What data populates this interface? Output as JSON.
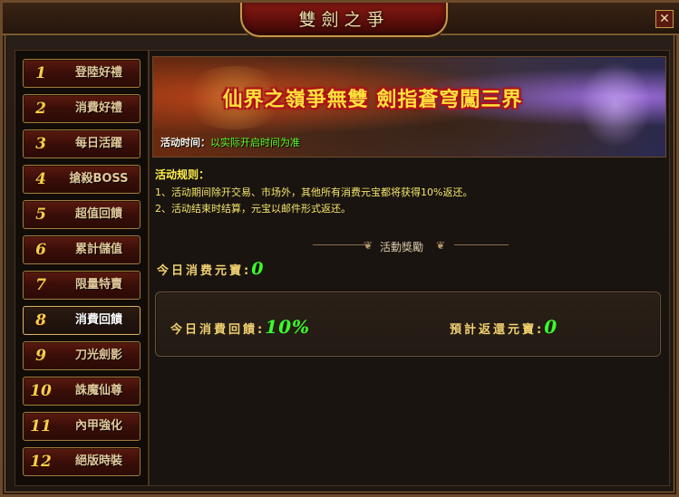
{
  "window": {
    "title": "雙劍之爭",
    "close_label": "✕"
  },
  "sidebar": {
    "items": [
      {
        "num": "1",
        "label": "登陸好禮"
      },
      {
        "num": "2",
        "label": "消費好禮"
      },
      {
        "num": "3",
        "label": "每日活躍"
      },
      {
        "num": "4",
        "label": "搶殺BOSS"
      },
      {
        "num": "5",
        "label": "超值回饋"
      },
      {
        "num": "6",
        "label": "累計儲值"
      },
      {
        "num": "7",
        "label": "限量特賣"
      },
      {
        "num": "8",
        "label": "消費回饋"
      },
      {
        "num": "9",
        "label": "刀光劍影"
      },
      {
        "num": "10",
        "label": "誅魔仙尊"
      },
      {
        "num": "11",
        "label": "內甲強化"
      },
      {
        "num": "12",
        "label": "絕版時裝"
      }
    ],
    "active_index": 7
  },
  "banner": {
    "slogan": "仙界之嶺爭無雙 劍指蒼穹闖三界",
    "time_label": "活动时间：",
    "time_value": "以实际开启时间为准"
  },
  "rules": {
    "title": "活动规则：",
    "line1": "1、活动期间除开交易、市场外，其他所有消费元宝都将获得10%返还。",
    "line2": "2、活动结束时结算，元宝以邮件形式返还。"
  },
  "reward_section": {
    "title": "活動獎勵",
    "today_spend_label": "今日消费元寶:",
    "today_spend_value": "0",
    "today_rebate_label": "今日消費回饋:",
    "today_rebate_value": "10%",
    "expected_return_label": "預計返還元寶:",
    "expected_return_value": "0"
  },
  "colors": {
    "accent_gold": "#f0d070",
    "value_green": "#3aff2a",
    "frame_bronze": "#a07a3a"
  }
}
